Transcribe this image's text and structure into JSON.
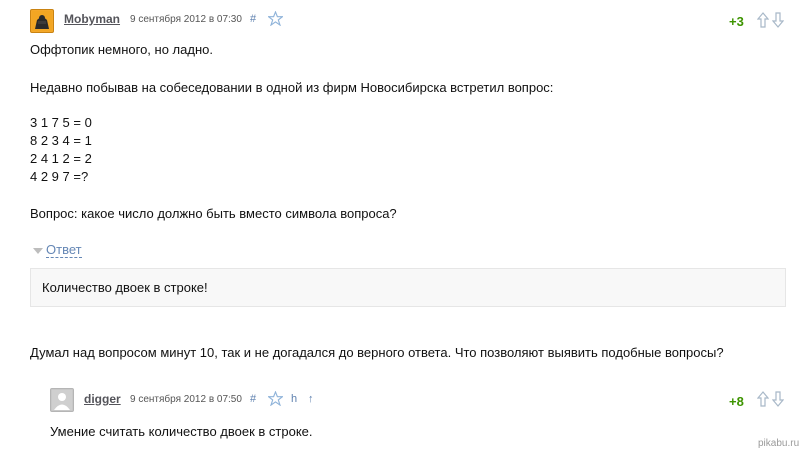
{
  "comment1": {
    "username": "Mobyman",
    "date": "9 сентября 2012 в 07:30",
    "hash": "#",
    "rating": "+3",
    "lines": [
      "Оффтопик немного, но ладно.",
      "Недавно побывав на собеседовании в одной из фирм Новосибирска встретил вопрос:",
      "3 1 7 5 = 0",
      "8 2 3 4 = 1",
      "2 4 1 2 = 2",
      "4 2 9 7 =?",
      "Вопрос: какое число должно быть вместо символа вопроса?"
    ],
    "spoiler_label": "Ответ",
    "spoiler_text": "Количество двоек в строке!",
    "after_text": "Думал над вопросом минут 10, так и не догадался до верного ответа. Что позволяют выявить подобные вопросы?"
  },
  "comment2": {
    "username": "digger",
    "date": "9 сентября 2012 в 07:50",
    "hash": "#",
    "parent_link": "h",
    "up_arrow": "↑",
    "rating": "+8",
    "text": "Умение считать количество двоек в строке."
  },
  "watermark": "pikabu.ru",
  "colors": {
    "positive_rating": "#3d9400",
    "link": "#6587b5",
    "star": "#8fb3d9",
    "vote_arrow": "#a8b8c8"
  },
  "icons": [
    "avatar",
    "star-icon",
    "vote-up-icon",
    "vote-down-icon",
    "triangle-down-icon",
    "user-silhouette-icon"
  ]
}
